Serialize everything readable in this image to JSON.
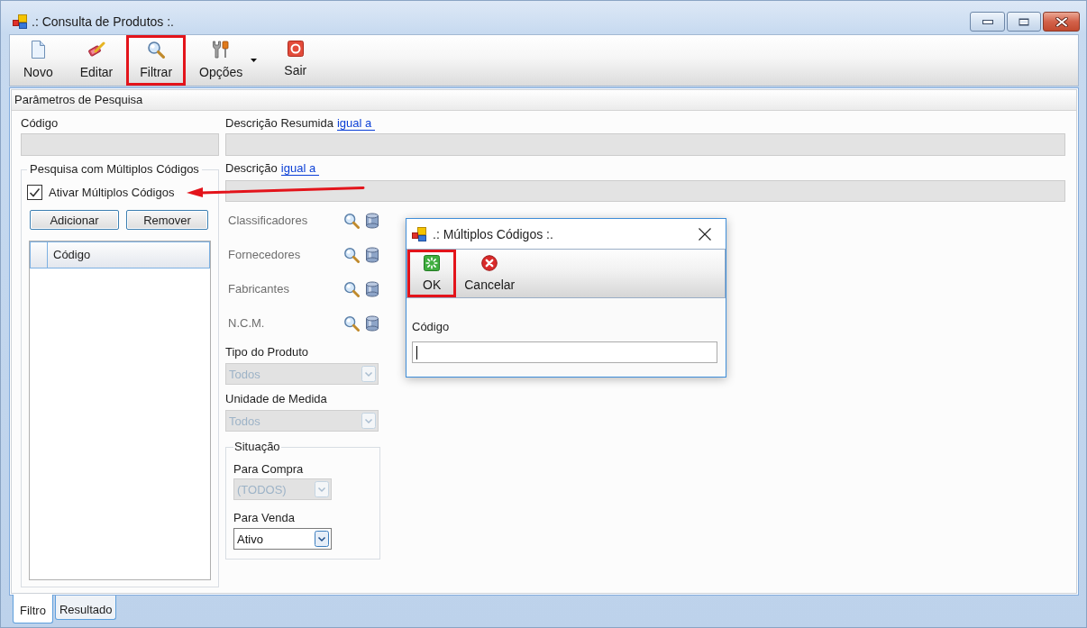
{
  "window": {
    "title": ".: Consulta de Produtos :."
  },
  "toolbar": [
    {
      "label": "Novo",
      "kind": "button",
      "highlighted": false
    },
    {
      "label": "Editar",
      "kind": "button",
      "highlighted": false
    },
    {
      "label": "Filtrar",
      "kind": "button",
      "highlighted": true
    },
    {
      "label": "Opções",
      "kind": "dropdown",
      "highlighted": false
    },
    {
      "label": "Sair",
      "kind": "button",
      "highlighted": false
    }
  ],
  "panel": {
    "title": "Parâmetros de Pesquisa"
  },
  "codigo": {
    "label": "Código",
    "disabled": true
  },
  "multi_codes": {
    "title": "Pesquisa com Múltiplos Códigos",
    "checkbox": {
      "label": "Ativar Múltiplos Códigos",
      "checked": true
    },
    "buttons": [
      "Adicionar",
      "Remover"
    ],
    "grid": {
      "columns": [
        "Código"
      ]
    }
  },
  "description_fields": [
    {
      "label": "Descrição Resumida",
      "link": "igual a",
      "disabled": true
    },
    {
      "label": "Descrição",
      "link": "igual a",
      "disabled": true
    }
  ],
  "lookups": [
    {
      "label": "Classificadores",
      "disabled": true
    },
    {
      "label": "Fornecedores",
      "disabled": true
    },
    {
      "label": "Fabricantes",
      "disabled": true
    },
    {
      "label": "N.C.M.",
      "disabled": true
    }
  ],
  "combos": [
    {
      "label": "Tipo do Produto",
      "value": "Todos",
      "disabled": true
    },
    {
      "label": "Unidade de Medida",
      "value": "Todos",
      "disabled": true
    }
  ],
  "situacao": {
    "title": "Situação",
    "combos": [
      {
        "label": "Para Compra",
        "value": "(TODOS)",
        "disabled": true
      },
      {
        "label": "Para Venda",
        "value": "Ativo",
        "disabled": false
      }
    ]
  },
  "dialog": {
    "title": ".: Múltiplos Códigos :.",
    "toolbar": [
      {
        "label": "OK",
        "highlighted": true
      },
      {
        "label": "Cancelar",
        "highlighted": false
      }
    ],
    "field": {
      "label": "Código",
      "focused": true
    }
  },
  "annotations": [
    {
      "kind": "arrow"
    }
  ],
  "tabs": [
    {
      "label": "Filtro",
      "selected": true
    },
    {
      "label": "Resultado",
      "selected": false
    }
  ]
}
